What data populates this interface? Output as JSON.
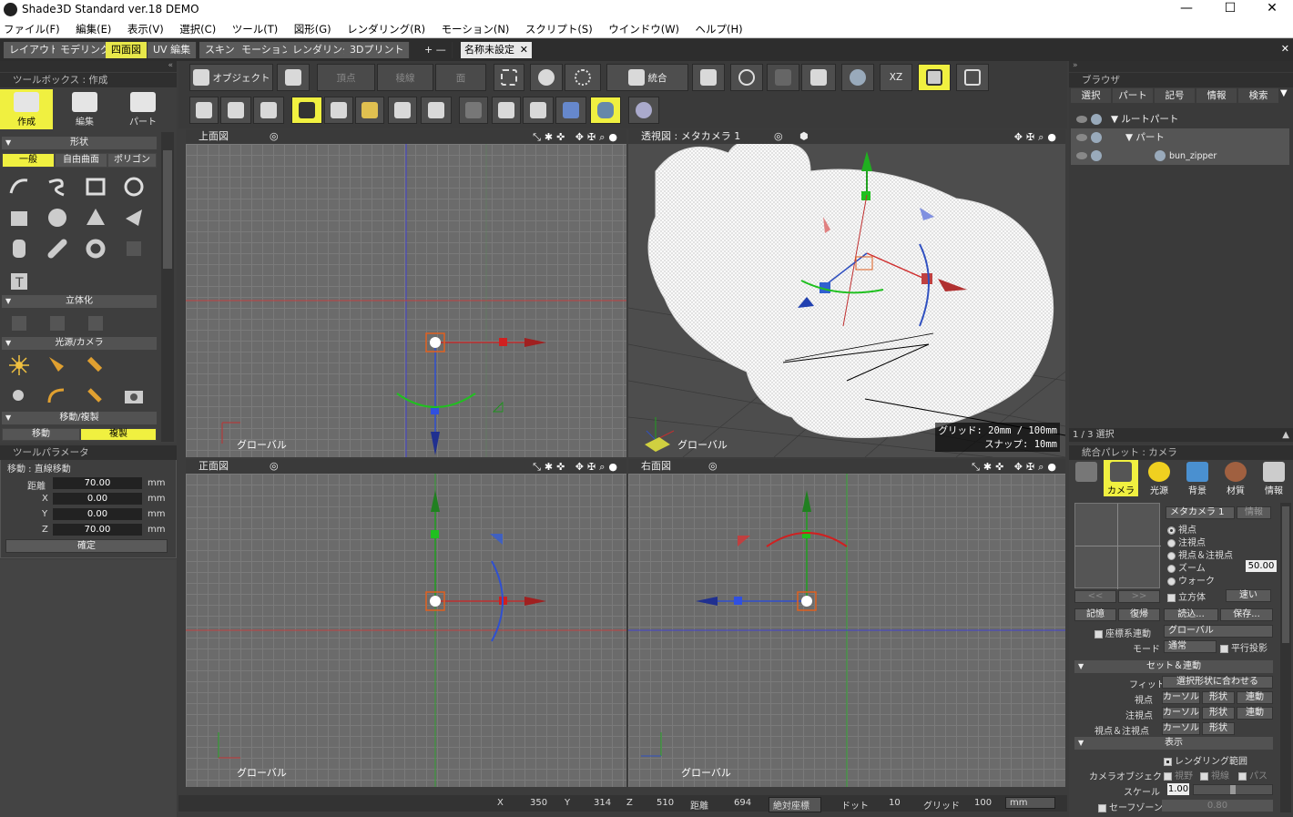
{
  "window": {
    "title": "Shade3D Standard ver.18 DEMO",
    "minimize": "—",
    "maximize": "☐",
    "close": "✕"
  },
  "menu": [
    "ファイル(F)",
    "編集(E)",
    "表示(V)",
    "選択(C)",
    "ツール(T)",
    "図形(G)",
    "レンダリング(R)",
    "モーション(N)",
    "スクリプト(S)",
    "ウインドウ(W)",
    "ヘルプ(H)"
  ],
  "modeTabs": [
    "レイアウト",
    "モデリング",
    "四面図",
    "UV 編集",
    "スキン",
    "モーション",
    "レンダリング",
    "3Dプリント"
  ],
  "activeModeTab": "四面図",
  "tabAdd": "+ —",
  "docTab": {
    "label": "名称未設定",
    "close": "✕"
  },
  "toolbox": {
    "header": "ツールボックス : 作成",
    "modes": [
      "作成",
      "編集",
      "パート"
    ],
    "sections": {
      "shape": "形状",
      "solidify": "立体化",
      "light": "光源/カメラ",
      "move": "移動/複製"
    },
    "shapeTabs": [
      "一般",
      "自由曲面",
      "ポリゴン"
    ],
    "moveTabs": [
      "移動",
      "複製"
    ]
  },
  "toolParams": {
    "header": "ツールパラメータ",
    "mode": "移動 : 直線移動",
    "rows": [
      {
        "label": "距離",
        "value": "70.00",
        "unit": "mm"
      },
      {
        "label": "X",
        "value": "0.00",
        "unit": "mm"
      },
      {
        "label": "Y",
        "value": "0.00",
        "unit": "mm"
      },
      {
        "label": "Z",
        "value": "70.00",
        "unit": "mm"
      }
    ],
    "confirm": "確定"
  },
  "toolbar": {
    "object": "オブジェクト",
    "vertex": "頂点",
    "edge": "稜線",
    "face": "面",
    "merge": "統合",
    "xz": "XZ"
  },
  "viewports": {
    "top": {
      "title": "上面図",
      "coord": "グローバル"
    },
    "persp": {
      "title": "透視図 : メタカメラ 1",
      "coord": "グローバル",
      "grid": "グリッド: 20mm / 100mm",
      "snap": "スナップ: 10mm"
    },
    "front": {
      "title": "正面図",
      "coord": "グローバル"
    },
    "right": {
      "title": "右面図",
      "coord": "グローバル"
    }
  },
  "status": {
    "x_label": "X",
    "x": "350",
    "y_label": "Y",
    "y": "314",
    "z_label": "Z",
    "z": "510",
    "dist_label": "距離",
    "dist": "694",
    "coord_mode": "絶対座標",
    "dot_label": "ドット",
    "dot": "10",
    "grid_label": "グリッド",
    "grid": "100",
    "unit": "mm"
  },
  "browser": {
    "header": "ブラウザ",
    "tabs": [
      "選択",
      "パート",
      "記号",
      "情報",
      "検索"
    ],
    "tree": [
      "ルートパート",
      "パート",
      "bun_zipper"
    ],
    "footer": "1 / 3 選択"
  },
  "palette": {
    "header": "統合パレット : カメラ",
    "buttons": [
      "カメラ",
      "光源",
      "背景",
      "材質",
      "情報"
    ],
    "camera": "メタカメラ 1",
    "info_btn": "情報",
    "options": [
      "視点",
      "注視点",
      "視点＆注視点",
      "ズーム",
      "ウォーク"
    ],
    "zoom": "50.00",
    "cube": "立方体",
    "speed": "速い",
    "nav_prev": "<<",
    "nav_next": ">>",
    "memory": "記憶",
    "restore": "復帰",
    "load": "読込...",
    "save": "保存...",
    "coord_link": "座標系連動",
    "coord_value": "グローバル",
    "mode_label": "モード",
    "mode_value": "通常",
    "parallel": "平行投影",
    "set_link": "セット＆連動",
    "fit_label": "フィット",
    "fit_btn": "選択形状に合わせる",
    "rows": [
      {
        "label": "視点",
        "b1": "カーソル",
        "b2": "形状",
        "b3": "連動"
      },
      {
        "label": "注視点",
        "b1": "カーソル",
        "b2": "形状",
        "b3": "連動"
      },
      {
        "label": "視点＆注視点",
        "b1": "カーソル",
        "b2": "形状",
        "b3": ""
      }
    ],
    "display": "表示",
    "render_range": "レンダリング範囲",
    "camobj_label": "カメラオブジェクト",
    "camobj_opts": [
      "視野",
      "視線",
      "パス"
    ],
    "scale_label": "スケール",
    "scale": "1.00",
    "safezone": "セーフゾーン",
    "safezone_val": "0.80"
  },
  "colors": {
    "accent": "#f0f040",
    "axisX": "#d03030",
    "axisY": "#20a020",
    "axisZ": "#2040c0"
  }
}
